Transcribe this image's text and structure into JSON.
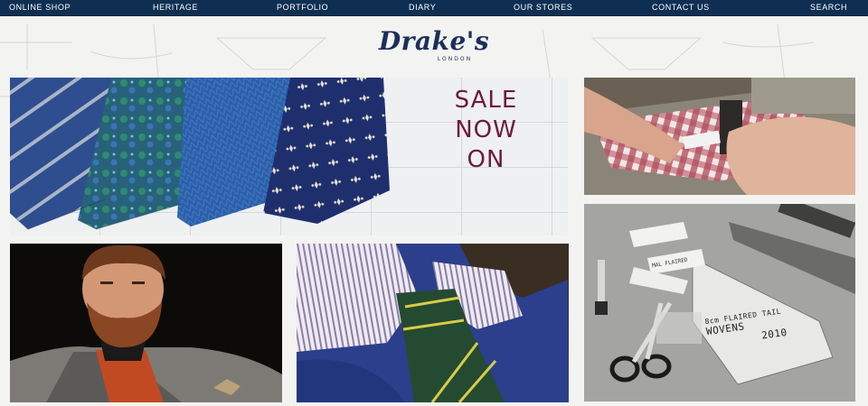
{
  "nav": {
    "items": [
      {
        "label": "ONLINE SHOP"
      },
      {
        "label": "HERITAGE"
      },
      {
        "label": "PORTFOLIO"
      },
      {
        "label": "DIARY"
      },
      {
        "label": "OUR STORES"
      },
      {
        "label": "CONTACT US"
      },
      {
        "label": "SEARCH"
      }
    ]
  },
  "logo": {
    "name": "Drake's",
    "subtitle": "LONDON",
    "color": "#1b2f5a"
  },
  "sale_banner": {
    "lines": [
      "SALE",
      "NOW",
      "ON"
    ],
    "color": "#6d1b3c"
  },
  "workshop": {
    "pattern_label_lines": [
      "8cm FLAIRED TAIL",
      "WOVENS",
      "2010"
    ],
    "tag_text": "MAL FLAIRED"
  },
  "colors": {
    "nav_bg": "#0f2f52",
    "nav_text": "#ffffff",
    "page_bg": "#f3f3f1"
  }
}
